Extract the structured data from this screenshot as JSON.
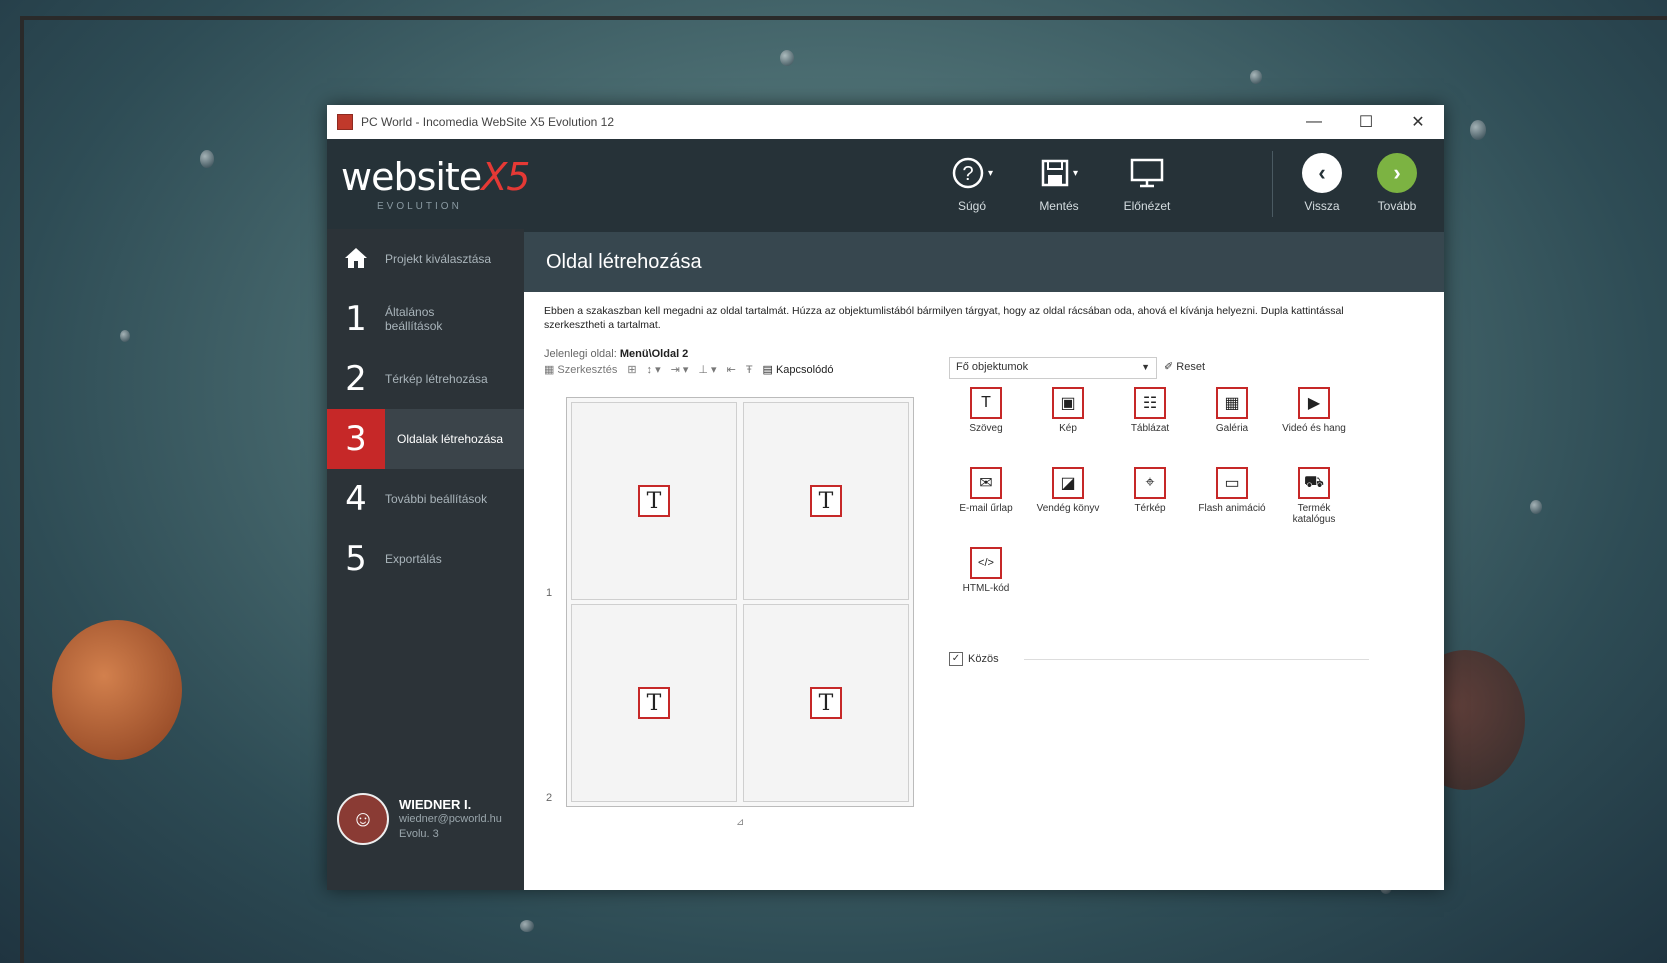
{
  "window": {
    "title": "PC World - Incomedia WebSite X5 Evolution 12",
    "controls": {
      "minimize": "—",
      "maximize": "☐",
      "close": "✕"
    }
  },
  "logo": {
    "main": "website",
    "x5": "X5",
    "sub": "EVOLUTION"
  },
  "toolbar": {
    "help": {
      "icon": "help-icon",
      "label": "Súgó"
    },
    "save": {
      "icon": "save-icon",
      "label": "Mentés"
    },
    "preview": {
      "icon": "monitor-icon",
      "label": "Előnézet"
    },
    "back": {
      "icon": "chevron-left-icon",
      "label": "Vissza"
    },
    "next": {
      "icon": "chevron-right-icon",
      "label": "Tovább"
    }
  },
  "sidebar": {
    "steps": [
      {
        "num": "",
        "label": "Projekt kiválasztása"
      },
      {
        "num": "1",
        "label": "Általános beállítások"
      },
      {
        "num": "2",
        "label": "Térkép létrehozása"
      },
      {
        "num": "3",
        "label": "Oldalak létrehozása"
      },
      {
        "num": "4",
        "label": "További beállítások"
      },
      {
        "num": "5",
        "label": "Exportálás"
      }
    ],
    "user": {
      "name": "WIEDNER I.",
      "email": "wiedner@pcworld.hu",
      "plan": "Evolu. 3"
    }
  },
  "content": {
    "header": "Oldal létrehozása",
    "description": "Ebben a szakaszban kell megadni az oldal tartalmát. Húzza az objektumlistából bármilyen tárgyat, hogy az oldal rácsában oda, ahová el kívánja helyezni. Dupla kattintással szerkesztheti a tartalmat.",
    "current_label": "Jelenlegi oldal:",
    "current_page": "Menü\\Oldal 2",
    "grid_toolbar": {
      "delete": "Szerkesztés",
      "properties": "Kapcsolódó"
    },
    "rows": [
      "1",
      "2"
    ],
    "grid_footer": "⊿",
    "object_select": "Fő objektumok",
    "reset": "Reset",
    "objects": [
      {
        "icon": "T",
        "label": "Szöveg"
      },
      {
        "icon": "▣",
        "label": "Kép"
      },
      {
        "icon": "☷",
        "label": "Táblázat"
      },
      {
        "icon": "▦",
        "label": "Galéria"
      },
      {
        "icon": "▶",
        "label": "Videó és hang"
      },
      {
        "icon": "✉",
        "label": "E-mail űrlap"
      },
      {
        "icon": "◪",
        "label": "Vendég könyv"
      },
      {
        "icon": "⌖",
        "label": "Térkép"
      },
      {
        "icon": "▭",
        "label": "Flash animáció"
      },
      {
        "icon": "⛟",
        "label": "Termék katalógus"
      },
      {
        "icon": "</>",
        "label": "HTML-kód"
      }
    ],
    "common": {
      "check": "✓",
      "label": "Közös"
    }
  }
}
